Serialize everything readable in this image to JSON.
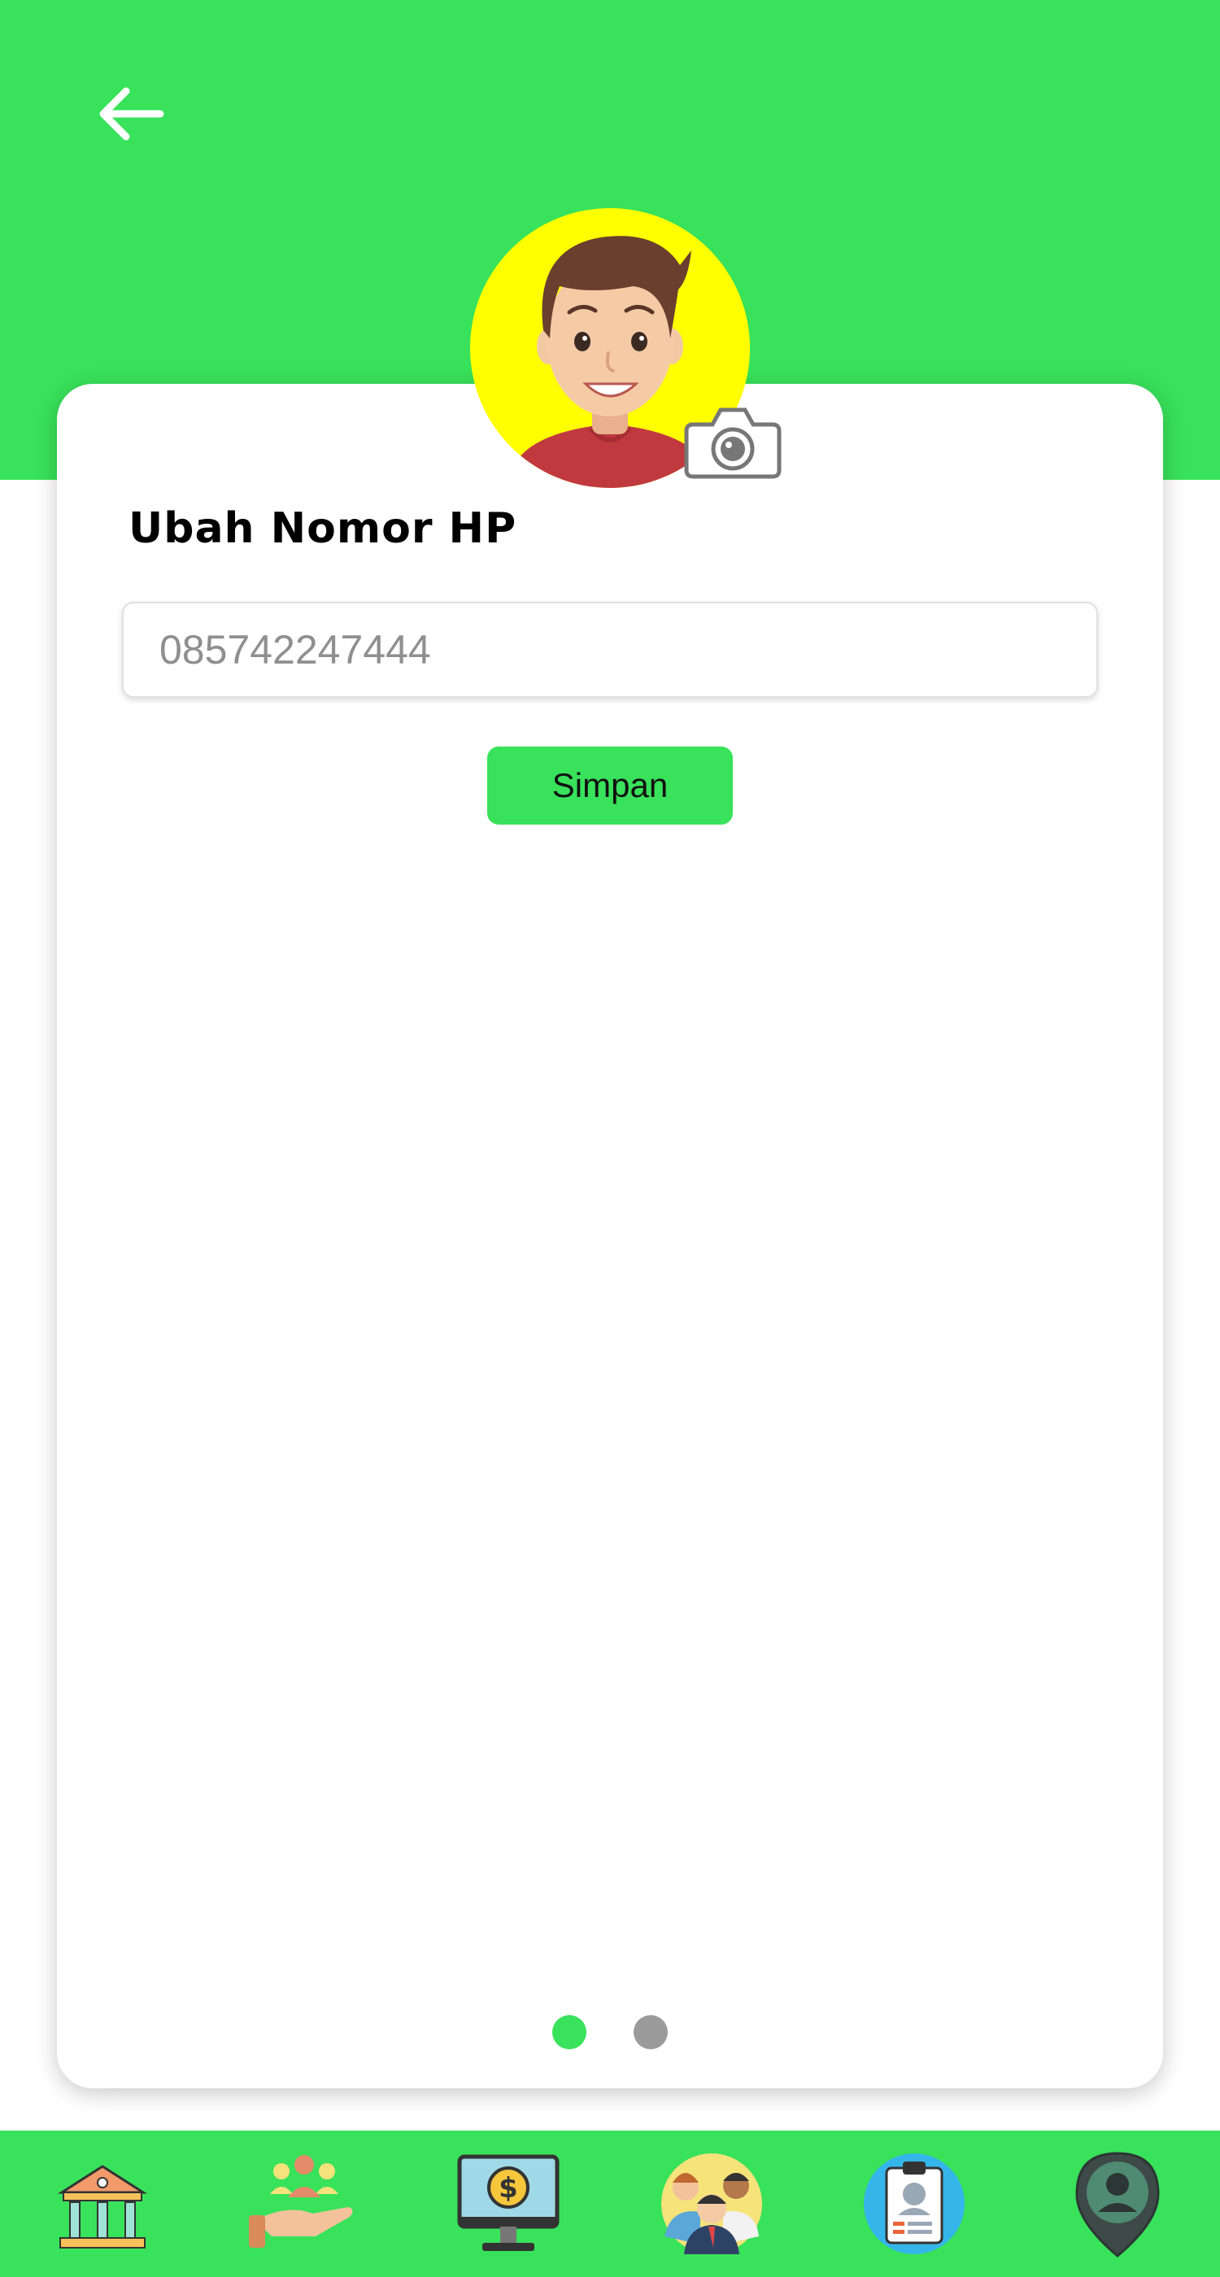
{
  "header": {
    "back_icon": "arrow-left-icon",
    "background_color": "#38e25a"
  },
  "profile": {
    "avatar_icon": "user-avatar",
    "avatar_bg": "#ffff00",
    "camera_icon": "camera-icon"
  },
  "form": {
    "title": "Ubah Nomor HP",
    "phone_placeholder": "085742247444",
    "phone_value": "",
    "save_label": "Simpan"
  },
  "pager": {
    "pages": 2,
    "active_index": 0,
    "active_color": "#38e25a",
    "inactive_color": "#9a9a9a"
  },
  "bottom_nav": {
    "items": [
      {
        "icon": "bank-building-icon"
      },
      {
        "icon": "community-hand-icon"
      },
      {
        "icon": "computer-dollar-icon"
      },
      {
        "icon": "team-people-icon"
      },
      {
        "icon": "id-card-clipboard-icon"
      },
      {
        "icon": "location-person-pin-icon"
      }
    ]
  }
}
